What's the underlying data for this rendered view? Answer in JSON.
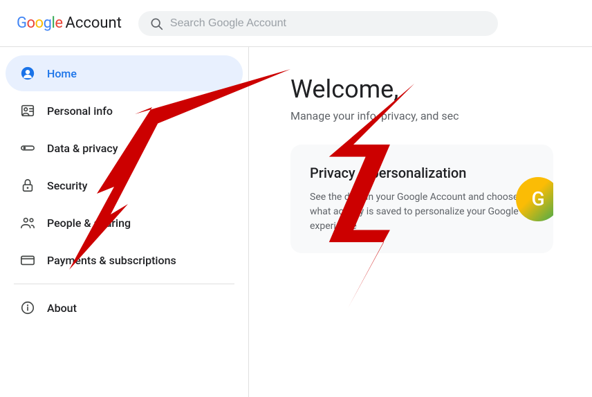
{
  "header": {
    "logo_google": "Google",
    "logo_account": "Account",
    "search_placeholder": "Search Google Account"
  },
  "sidebar": {
    "items": [
      {
        "id": "home",
        "label": "Home",
        "active": true
      },
      {
        "id": "personal-info",
        "label": "Personal info",
        "active": false
      },
      {
        "id": "data-privacy",
        "label": "Data & privacy",
        "active": false
      },
      {
        "id": "security",
        "label": "Security",
        "active": false
      },
      {
        "id": "people-sharing",
        "label": "People & sharing",
        "active": false
      },
      {
        "id": "payments",
        "label": "Payments & subscriptions",
        "active": false
      },
      {
        "id": "about",
        "label": "About",
        "active": false
      }
    ]
  },
  "main": {
    "welcome": "Welcome,",
    "subtitle": "Manage your info, privacy, and sec",
    "card": {
      "title": "Privacy & personalization",
      "text": "See the data in your Google Account and choose what activity is saved to personalize your Google experience"
    }
  }
}
